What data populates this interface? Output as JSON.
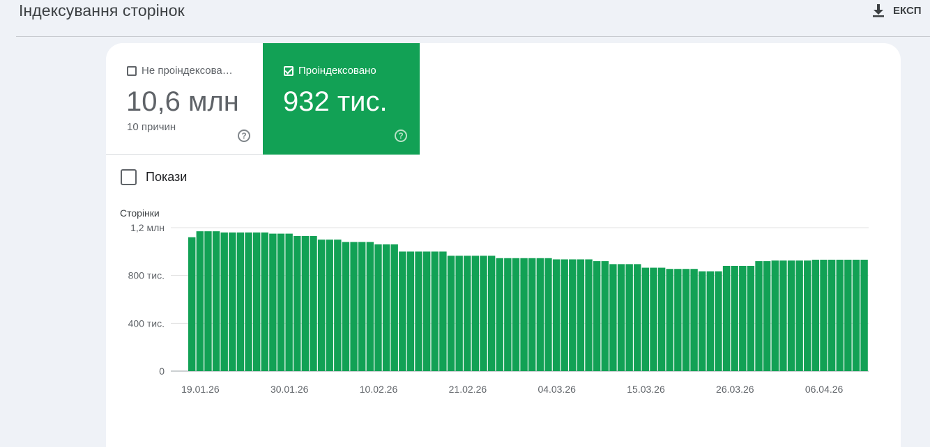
{
  "header": {
    "title": "Індексування сторінок",
    "export_label": "ЕКСП"
  },
  "tiles": {
    "not_indexed": {
      "label": "Не проіндексова…",
      "value": "10,6 млн",
      "sub": "10 причин",
      "checked": false
    },
    "indexed": {
      "label": "Проіндексовано",
      "value": "932 тис.",
      "checked": true,
      "color": "#12a155"
    }
  },
  "impressions": {
    "label": "Покази",
    "checked": false
  },
  "chart_data": {
    "type": "bar",
    "ylabel": "Сторінки",
    "ylim": [
      0,
      1200000
    ],
    "yticks": [
      {
        "value": 0,
        "label": "0"
      },
      {
        "value": 400000,
        "label": "400 тис."
      },
      {
        "value": 800000,
        "label": "800 тис."
      },
      {
        "value": 1200000,
        "label": "1,2 млн"
      }
    ],
    "xtick_labels": [
      "19.01.26",
      "30.01.26",
      "10.02.26",
      "21.02.26",
      "04.03.26",
      "15.03.26",
      "26.03.26",
      "06.04.26"
    ],
    "x_start": "18.01.26",
    "x_end": "11.04.26",
    "bar_color": "#12a155",
    "series": [
      {
        "values": [
          1120000,
          1170000,
          1170000,
          1170000,
          1160000,
          1160000,
          1160000,
          1160000,
          1160000,
          1160000,
          1150000,
          1150000,
          1150000,
          1130000,
          1130000,
          1130000,
          1100000,
          1100000,
          1100000,
          1080000,
          1080000,
          1080000,
          1080000,
          1060000,
          1060000,
          1060000,
          1000000,
          1000000,
          1000000,
          1000000,
          1000000,
          1000000,
          965000,
          965000,
          965000,
          965000,
          965000,
          965000,
          945000,
          945000,
          945000,
          945000,
          945000,
          945000,
          945000,
          935000,
          935000,
          935000,
          935000,
          935000,
          920000,
          920000,
          895000,
          895000,
          895000,
          895000,
          865000,
          865000,
          865000,
          855000,
          855000,
          855000,
          855000,
          835000,
          835000,
          835000,
          880000,
          880000,
          880000,
          880000,
          920000,
          920000,
          925000,
          925000,
          925000,
          925000,
          925000,
          932000,
          932000,
          932000,
          932000,
          932000,
          932000,
          932000
        ]
      }
    ]
  }
}
